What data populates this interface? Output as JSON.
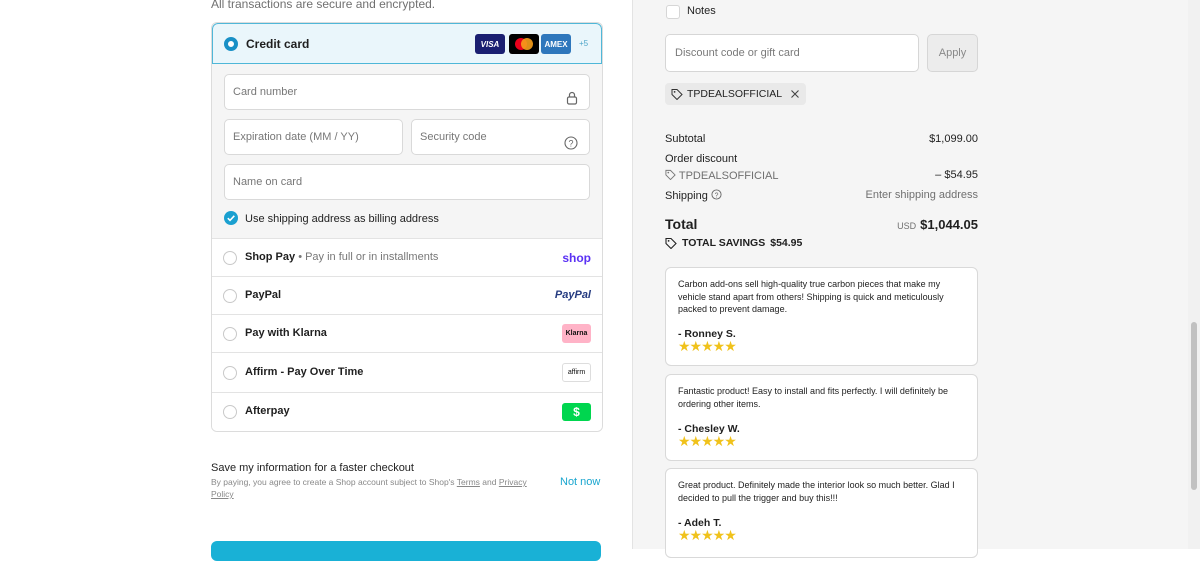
{
  "payment": {
    "secure_note": "All transactions are secure and encrypted.",
    "credit_card_label": "Credit card",
    "brands": [
      {
        "name": "VISA",
        "color": "#1a1f71"
      },
      {
        "name": "mastercard",
        "color": "#000000"
      },
      {
        "name": "AMEX",
        "color": "#2e77bc"
      }
    ],
    "more_brands": "+5",
    "card_number_placeholder": "Card number",
    "expiration_placeholder": "Expiration date (MM / YY)",
    "security_code_placeholder": "Security code",
    "name_on_card_placeholder": "Name on card",
    "billing_same_label": "Use shipping address as billing address",
    "methods": [
      {
        "label": "Shop Pay",
        "sub": "• Pay in full or in installments",
        "logo_text": "shop"
      },
      {
        "label": "PayPal",
        "logo_text": "PayPal"
      },
      {
        "label": "Pay with Klarna",
        "logo_text": "Klarna"
      },
      {
        "label": "Affirm - Pay Over Time",
        "logo_text": "affirm"
      },
      {
        "label": "Afterpay",
        "logo_text": "$"
      }
    ]
  },
  "save_info": {
    "title": "Save my information for a faster checkout",
    "sub_prefix": "By paying, you agree to create a Shop account subject to Shop's",
    "terms": "Terms",
    "and": "and",
    "privacy": "Privacy Policy",
    "not_now": "Not now"
  },
  "summary": {
    "notes_label": "Notes",
    "discount_placeholder": "Discount code or gift card",
    "apply_label": "Apply",
    "applied_code": "TPDEALSOFFICIAL",
    "subtotal_label": "Subtotal",
    "subtotal_value": "$1,099.00",
    "order_discount_label": "Order discount",
    "discount_code": "TPDEALSOFFICIAL",
    "discount_value": "– $54.95",
    "shipping_label": "Shipping",
    "shipping_value": "Enter shipping address",
    "total_label": "Total",
    "currency": "USD",
    "total_value": "$1,044.05",
    "savings_label": "TOTAL SAVINGS",
    "savings_value": "$54.95"
  },
  "reviews": [
    {
      "text": "Carbon add-ons sell high-quality true carbon pieces that make my vehicle stand apart from others! Shipping is quick and meticulously packed to prevent damage.",
      "author": "- Ronney S.",
      "stars": "★★★★★"
    },
    {
      "text": "Fantastic product! Easy to install and fits perfectly. I will definitely be ordering other items.",
      "author": "- Chesley W.",
      "stars": "★★★★★"
    },
    {
      "text": "Great product. Definitely made the interior look so much better. Glad I decided to pull the trigger and buy this!!!",
      "author": "- Adeh T.",
      "stars": "★★★★★"
    }
  ],
  "colors": {
    "accent": "#1990c6",
    "button": "#19b1d6",
    "star": "#f0c21b",
    "shop_purple": "#5a31f4",
    "klarna_pink": "#ffb3c7",
    "afterpay_green": "#00d64f"
  }
}
